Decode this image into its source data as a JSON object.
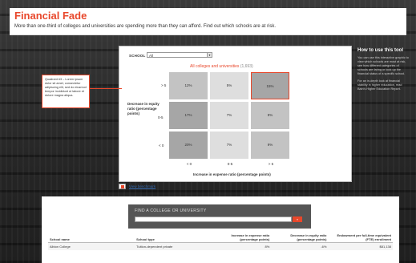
{
  "header": {
    "title": "Financial Fade",
    "subtitle": "More than one-third of colleges and universities are spending more than they can afford. Find out which schools are at risk."
  },
  "tool": {
    "school_type_label": "SCHOOL TYPE:",
    "school_type_value": "All",
    "chart_title": "All colleges and universities",
    "chart_count": "(1,693)",
    "y_axis_label": "Decrease in equity ratio (percentage points)",
    "x_axis_label": "Increase in expense ratio (percentage points)",
    "benchmark_link": "View benchmark"
  },
  "chart_data": {
    "type": "heatmap",
    "title": "All colleges and universities (1,693)",
    "ylabel": "Decrease in equity ratio (percentage points)",
    "xlabel": "Increase in expense ratio (percentage points)",
    "rows": [
      "> 5",
      "0-5",
      "< 0"
    ],
    "columns": [
      "< 0",
      "0-5",
      "> 5"
    ],
    "values": [
      [
        "12%",
        "5%",
        "15%"
      ],
      [
        "17%",
        "7%",
        "9%"
      ],
      [
        "20%",
        "7%",
        "9%"
      ]
    ],
    "selected_cell": {
      "row": "> 5",
      "column": "> 5"
    }
  },
  "note": {
    "text": "Quadrant #3 – Lorem ipsum dolor sit amet, consectetur adipiscing elit, sed do eiusmod tempor incididunt ut labore et dolore magna aliqua."
  },
  "info": {
    "heading": "How to use this tool",
    "para1": "You can use this interactive graphic to view which schools are most at risk, see how different categories of schools are faring or look up the financial status of a specific school.",
    "para2": "For an in-depth look at financial stability in higher education, read Bain's Higher Education Report."
  },
  "search": {
    "label": "FIND A COLLEGE OR UNIVERSITY",
    "go": "»"
  },
  "table": {
    "headers": [
      "School name",
      "School type",
      "Increase in expense ratio (percentage points)",
      "Decrease in equity ratio (percentage points)",
      "Endowment per full-time equivalent (FTE) enrollment"
    ],
    "rows": [
      [
        "Albion College",
        "Tuition-dependent private",
        "8%",
        "-6%",
        "$81,138"
      ]
    ]
  },
  "colors": {
    "accent": "#e8472b",
    "cell_dark": "#a6a6a6",
    "cell_mid": "#c3c3c3",
    "cell_light": "#dedede"
  }
}
